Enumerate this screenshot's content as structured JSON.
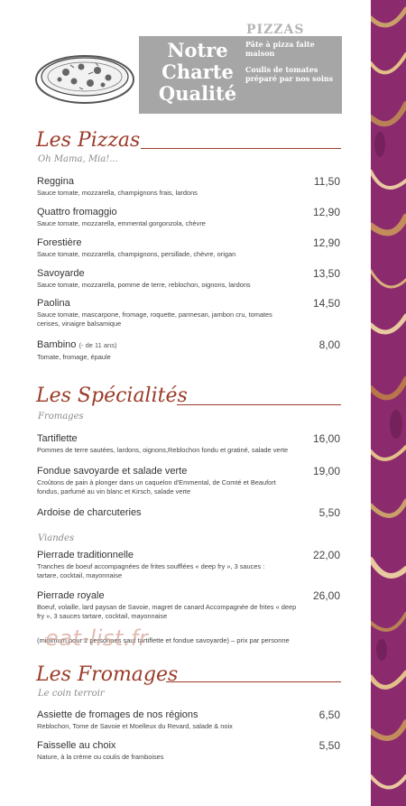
{
  "header": {
    "pizzas_word": "PIZZAS",
    "charte_lines": [
      "Notre",
      "Charte",
      "Qualité"
    ],
    "charte_points": [
      "Pâte à pizza faite maison",
      "Coulis de tomates préparé par nos soins"
    ],
    "illustration_icon": "pizza-drawing-icon"
  },
  "sections": {
    "pizzas": {
      "title": "Les Pizzas",
      "subtitle": "Oh Mama, Mia!...",
      "items": [
        {
          "name": "Reggina",
          "price": "11,50",
          "desc": "Sauce tomate, mozzarella, champignons frais, lardons"
        },
        {
          "name": "Quattro fromaggio",
          "price": "12,90",
          "desc": "Sauce tomate, mozzarella, emmental gorgonzola, chèvre"
        },
        {
          "name": "Forestière",
          "price": "12,90",
          "desc": "Sauce tomate, mozzarella, champignons, persillade, chèvre, origan"
        },
        {
          "name": "Savoyarde",
          "price": "13,50",
          "desc": "Sauce tomate, mozzarella, pomme de terre, reblochon, oignons, lardons"
        },
        {
          "name": "Paolina",
          "price": "14,50",
          "desc": "Sauce tomate, mascarpone, fromage, roquette, parmesan, jambon cru, tomates cerises, vinaigre balsamique"
        },
        {
          "name": "Bambino",
          "note": "(- de 11 ans)",
          "price": "8,00",
          "desc": "Tomate, fromage, épaule"
        }
      ]
    },
    "specialites": {
      "title": "Les Spécialités",
      "subtitle": "Fromages",
      "items": [
        {
          "name": "Tartiflette",
          "price": "16,00",
          "desc": "Pommes de terre sautées, lardons, oignons,Reblochon fondu et gratiné, salade verte"
        },
        {
          "name": "Fondue savoyarde et salade verte",
          "price": "19,00",
          "desc": "Croûtons de pain à plonger dans un caquelon d'Emmental, de Comté et Beaufort fondus, parfumé au vin blanc et Kirsch, salade verte"
        },
        {
          "name": "Ardoise de charcuteries",
          "price": "5,50",
          "desc": ""
        }
      ],
      "subtitle2": "Viandes",
      "items2": [
        {
          "name": "Pierrade traditionnelle",
          "price": "22,00",
          "desc": "Tranches de boeuf accompagnées de frites soufflées « deep fry », 3 sauces : tartare, cocktail, mayonnaise"
        },
        {
          "name": "Pierrade royale",
          "price": "26,00",
          "desc": "Boeuf, volaille, lard paysan de Savoie, magret de canard Accompagnée de frites « deep fry », 3 sauces tartare, cocktail, mayonnaise"
        }
      ],
      "minimum": "(minimum pour 2 personnes sauf tartiflette et fondue savoyarde) – prix par personne",
      "watermark": "eat-list.fr"
    },
    "fromages": {
      "title": "Les Fromages",
      "subtitle": "Le coin terroir",
      "items": [
        {
          "name": "Assiette de fromages de nos régions",
          "price": "6,50",
          "desc": "Reblochon, Tome de Savoie et Moelleux du Revard, salade & noix"
        },
        {
          "name": "Faisselle au choix",
          "price": "5,50",
          "desc": "Nature, à la crème ou coulis de framboises"
        }
      ]
    }
  },
  "colors": {
    "accent": "#9a3b28",
    "panel": "#a7a6a6",
    "strip": "#8c2a6e"
  }
}
